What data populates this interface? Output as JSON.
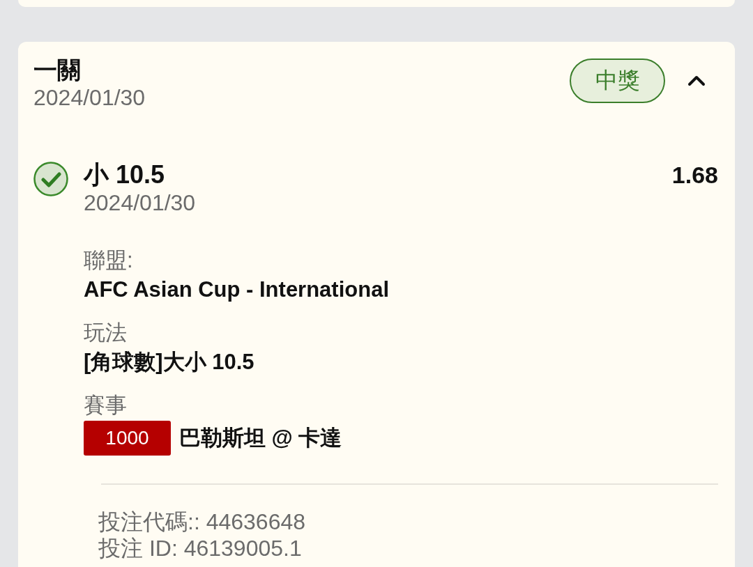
{
  "bet": {
    "title": "一關",
    "date": "2024/01/30",
    "badge": "中獎",
    "won": true,
    "expanded": true,
    "selections": [
      {
        "name": "小 10.5",
        "odds": "1.68",
        "date": "2024/01/30",
        "won": true,
        "details": [
          {
            "kind": "text",
            "label": "聯盟:",
            "value": "AFC Asian Cup - International"
          },
          {
            "kind": "text",
            "label": "玩法",
            "value": "[角球數]大小 10.5"
          },
          {
            "kind": "match",
            "label": "賽事",
            "code": "1000",
            "value": "巴勒斯坦 @ 卡達"
          }
        ]
      }
    ],
    "footer": [
      "投注代碼:: 44636648",
      "投注 ID: 46139005.1"
    ]
  }
}
